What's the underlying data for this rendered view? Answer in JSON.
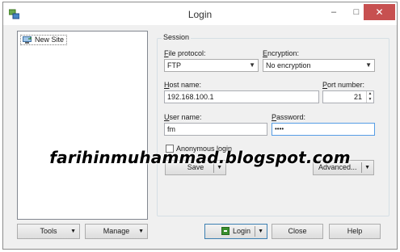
{
  "window": {
    "title": "Login",
    "minimize_glyph": "–",
    "maximize_glyph": "□",
    "close_glyph": "✕"
  },
  "site_tree": {
    "items": [
      {
        "label": "New Site",
        "icon": "computer-icon"
      }
    ]
  },
  "session": {
    "legend": "Session",
    "file_protocol": {
      "label_accel": "F",
      "label_rest": "ile protocol:",
      "value": "FTP"
    },
    "encryption": {
      "label_accel": "E",
      "label_rest": "ncryption:",
      "value": "No encryption"
    },
    "host_name": {
      "label_accel": "H",
      "label_rest": "ost name:",
      "value": "192.168.100.1"
    },
    "port_number": {
      "label_accel": "P",
      "label_rest": "ort number:",
      "value": "21"
    },
    "user_name": {
      "label_accel": "U",
      "label_rest": "ser name:",
      "value": "fm"
    },
    "password": {
      "label_accel": "P",
      "label_rest": "assword:",
      "value": "••••"
    },
    "anonymous_login": {
      "label": "Anonymous login",
      "checked": false
    },
    "save_label": "Save",
    "advanced_label": "Advanced..."
  },
  "bottom_bar": {
    "tools_label": "Tools",
    "manage_label": "Manage",
    "login_label": "Login",
    "close_label": "Close",
    "help_label": "Help"
  },
  "watermark": "farihinmuhammad.blogspot.com",
  "colors": {
    "close_button": "#c75050",
    "login_icon": "#3a8f2e",
    "focus_border": "#569de5"
  }
}
